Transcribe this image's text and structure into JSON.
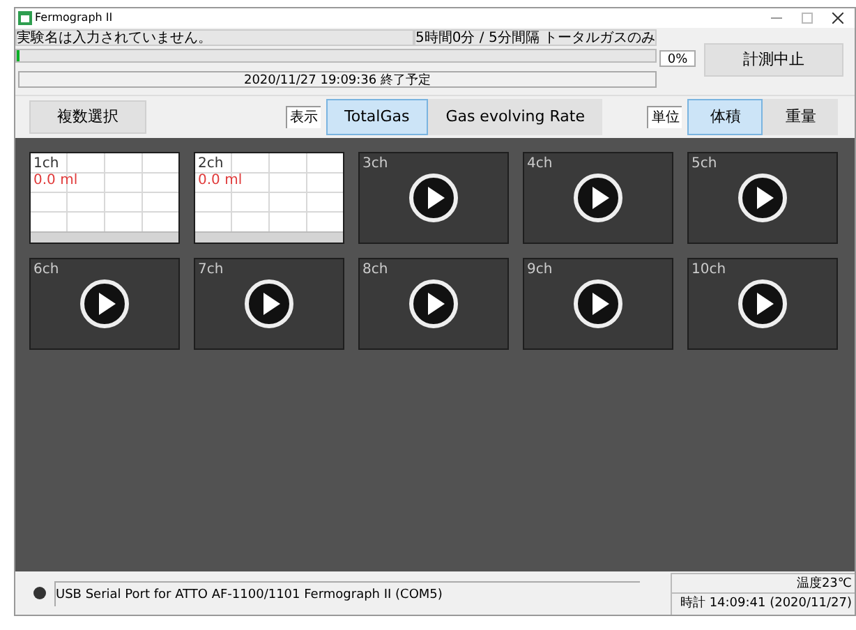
{
  "window": {
    "title": "Fermograph II"
  },
  "experiment": {
    "name": "実験名は入力されていません。",
    "schedule": "5時間0分 / 5分間隔 トータルガスのみ",
    "progress": {
      "level": 0.0,
      "reading": "0%"
    },
    "end_time": "2020/11/27 19:09:36 終了予定",
    "stop_button": "計測中止"
  },
  "toolbar": {
    "multi_select": "複数選択",
    "display_label": "表示",
    "display_tabs": [
      {
        "label": "TotalGas",
        "selected": true
      },
      {
        "label": "Gas evolving Rate",
        "selected": false
      }
    ],
    "unit_label": "単位",
    "unit_tabs": [
      {
        "label": "体積",
        "selected": true
      },
      {
        "label": "重量",
        "selected": false
      }
    ]
  },
  "channels": [
    {
      "name": "1ch",
      "kind": "graph",
      "value": "0.0 ml"
    },
    {
      "name": "2ch",
      "kind": "graph",
      "value": "0.0 ml"
    },
    {
      "name": "3ch",
      "kind": "idle"
    },
    {
      "name": "4ch",
      "kind": "idle"
    },
    {
      "name": "5ch",
      "kind": "idle"
    },
    {
      "name": "6ch",
      "kind": "idle"
    },
    {
      "name": "7ch",
      "kind": "idle"
    },
    {
      "name": "8ch",
      "kind": "idle"
    },
    {
      "name": "9ch",
      "kind": "idle"
    },
    {
      "name": "10ch",
      "kind": "idle"
    }
  ],
  "status_bar": {
    "port": "USB Serial Port for ATTO AF-1100/1101 Fermograph II (COM5)",
    "temperature": "温度23℃",
    "clock": "時計 14:09:41 (2020/11/27)"
  }
}
